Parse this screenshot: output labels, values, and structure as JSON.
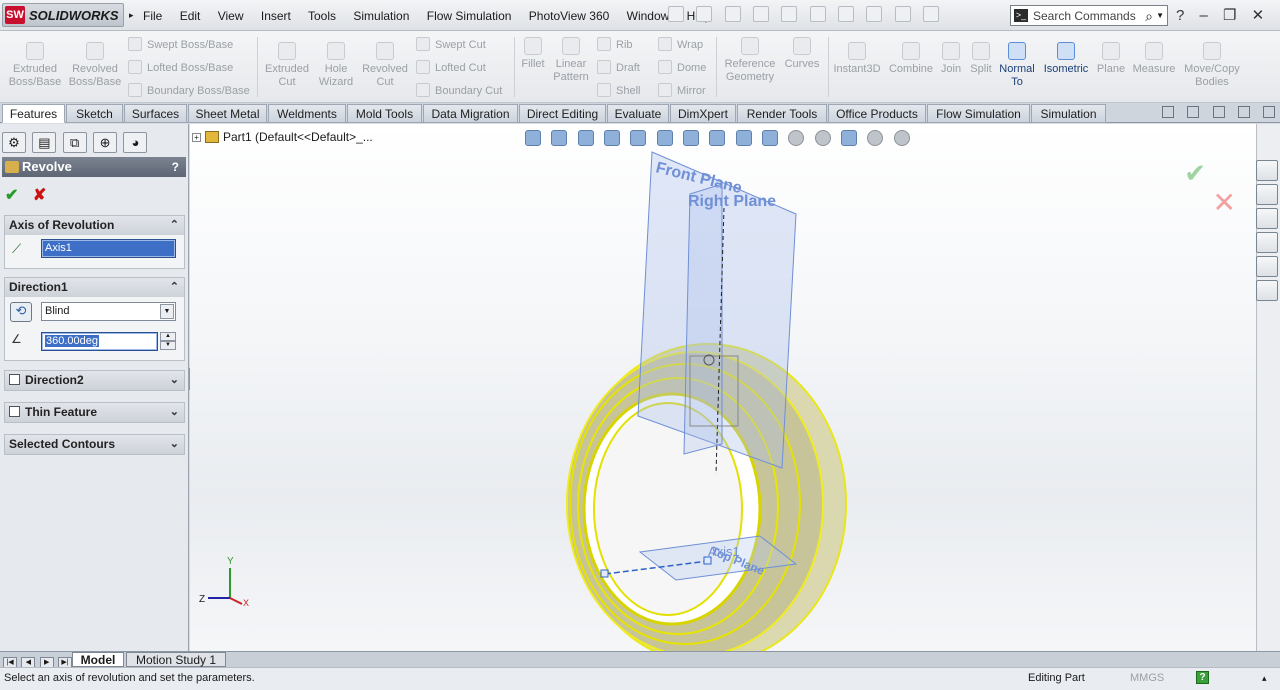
{
  "app": {
    "logo_text": "SOLIDWORKS",
    "logo_badge": "SW"
  },
  "menu": [
    "File",
    "Edit",
    "View",
    "Insert",
    "Tools",
    "Simulation",
    "Flow Simulation",
    "PhotoView 360",
    "Window",
    "Help"
  ],
  "search": {
    "placeholder": "Search Commands"
  },
  "commands": {
    "extruded_boss": "Extruded\nBoss/Base",
    "revolved_boss": "Revolved\nBoss/Base",
    "swept_boss": "Swept Boss/Base",
    "lofted_boss": "Lofted Boss/Base",
    "boundary_boss": "Boundary Boss/Base",
    "extruded_cut": "Extruded\nCut",
    "hole_wizard": "Hole\nWizard",
    "revolved_cut": "Revolved\nCut",
    "swept_cut": "Swept Cut",
    "lofted_cut": "Lofted Cut",
    "boundary_cut": "Boundary Cut",
    "fillet": "Fillet",
    "linear_pattern": "Linear\nPattern",
    "rib": "Rib",
    "draft": "Draft",
    "shell": "Shell",
    "wrap": "Wrap",
    "dome": "Dome",
    "mirror": "Mirror",
    "reference_geometry": "Reference\nGeometry",
    "curves": "Curves",
    "instant3d": "Instant3D",
    "combine": "Combine",
    "join": "Join",
    "split": "Split",
    "normal_to": "Normal\nTo",
    "isometric": "Isometric",
    "plane": "Plane",
    "measure": "Measure",
    "move_copy": "Move/Copy\nBodies"
  },
  "tabs": [
    "Features",
    "Sketch",
    "Surfaces",
    "Sheet Metal",
    "Weldments",
    "Mold Tools",
    "Data Migration",
    "Direct Editing",
    "Evaluate",
    "DimXpert",
    "Render Tools",
    "Office Products",
    "Flow Simulation",
    "Simulation"
  ],
  "property_manager": {
    "title": "Revolve",
    "help": "?",
    "axis_group": "Axis of Revolution",
    "axis_value": "Axis1",
    "direction1_group": "Direction1",
    "direction1_type": "Blind",
    "direction1_angle": "360.00deg",
    "direction2_group": "Direction2",
    "thin_group": "Thin Feature",
    "contours_group": "Selected Contours"
  },
  "graphics": {
    "tree_item": "Part1  (Default<<Default>_...",
    "front_plane": "Front Plane",
    "right_plane": "Right Plane",
    "top_plane": "Top Plane",
    "axis_label": "Axis1",
    "triad_x": "X",
    "triad_y": "Y",
    "triad_z": "Z"
  },
  "bottom_tabs": [
    "Model",
    "Motion Study 1"
  ],
  "status": {
    "message": "Select an axis of revolution and set the parameters.",
    "mode": "Editing Part",
    "units": "MMGS"
  },
  "colors": {
    "model_yellow": "#e8e600",
    "plane_blue": "#6f8fd6",
    "accent": "#3d6fc7"
  }
}
